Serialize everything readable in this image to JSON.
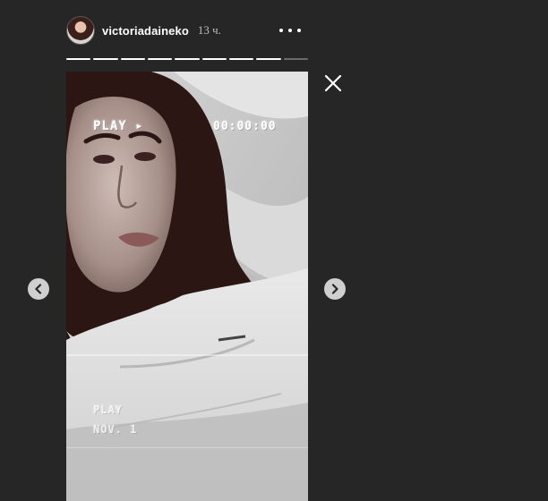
{
  "header": {
    "username": "victoriadaineko",
    "timestamp": "13 ч."
  },
  "story": {
    "segments_total": 9,
    "segments_watched": 8,
    "overlay_play": "PLAY ▸",
    "overlay_time": "00:00:00",
    "overlay_bottom_line1": "PLAY",
    "overlay_bottom_line2": "NOV. 1"
  },
  "icons": {
    "more": "more-options-icon",
    "close": "close-icon",
    "prev": "chevron-left-icon",
    "next": "chevron-right-icon"
  },
  "colors": {
    "background": "#262626",
    "progress_active": "#ffffff",
    "progress_remaining": "#6b6b6b",
    "nav_button": "#cfcfcf"
  }
}
